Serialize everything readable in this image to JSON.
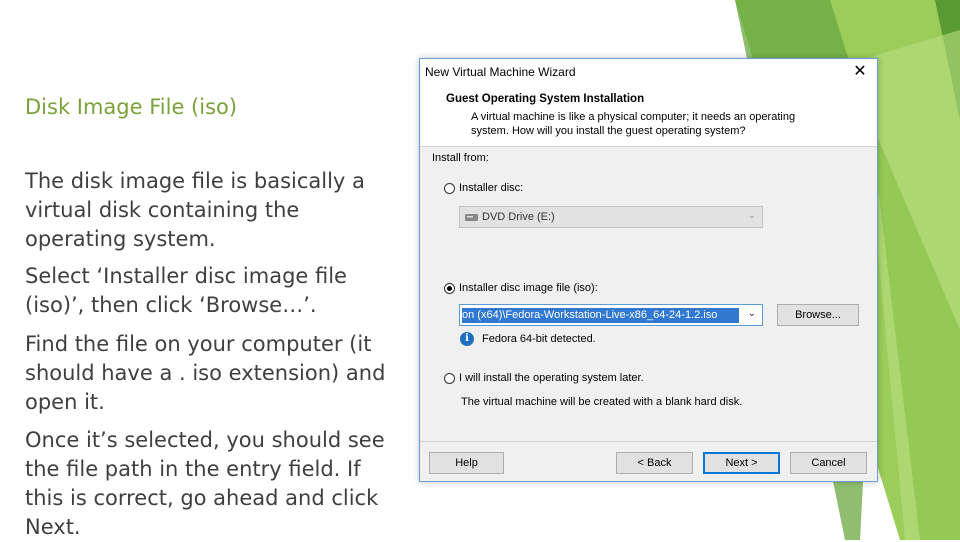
{
  "slide": {
    "heading": "Disk Image File (iso)",
    "paragraphs": [
      "The disk image file is basically a virtual disk containing the operating system.",
      "Select ‘Installer disc image file (iso)’, then click ‘Browse…’.",
      "Find the file on your computer (it should have a . iso extension) and open it.",
      "Once it’s selected, you should see the file path in the entry field. If this is correct, go ahead and click Next."
    ]
  },
  "dialog": {
    "title": "New Virtual Machine Wizard",
    "close_glyph": "✕",
    "header_title": "Guest Operating System Installation",
    "header_desc": "A virtual machine is like a physical computer; it needs an operating system. How will you install the guest operating system?",
    "install_from_label": "Install from:",
    "option_disc_label": "Installer disc:",
    "disc_drive_value": "DVD Drive (E:)",
    "option_iso_label": "Installer disc image file (iso):",
    "iso_path_value": "on (x64)\\Fedora-Workstation-Live-x86_64-24-1.2.iso",
    "browse_label": "Browse...",
    "detected_text": "Fedora 64-bit detected.",
    "option_later_label": "I will install the operating system later.",
    "later_desc": "The virtual machine will be created with a blank hard disk.",
    "help_label": "Help",
    "back_label": "< Back",
    "next_label": "Next >",
    "cancel_label": "Cancel",
    "selected_option": "iso"
  },
  "colors": {
    "accent_green": "#7ba23a",
    "selection_blue": "#3078d0",
    "dialog_border": "#6aa0d8"
  },
  "icons": [
    "close-icon",
    "dvd-drive-icon",
    "info-icon",
    "chevron-down-icon"
  ]
}
